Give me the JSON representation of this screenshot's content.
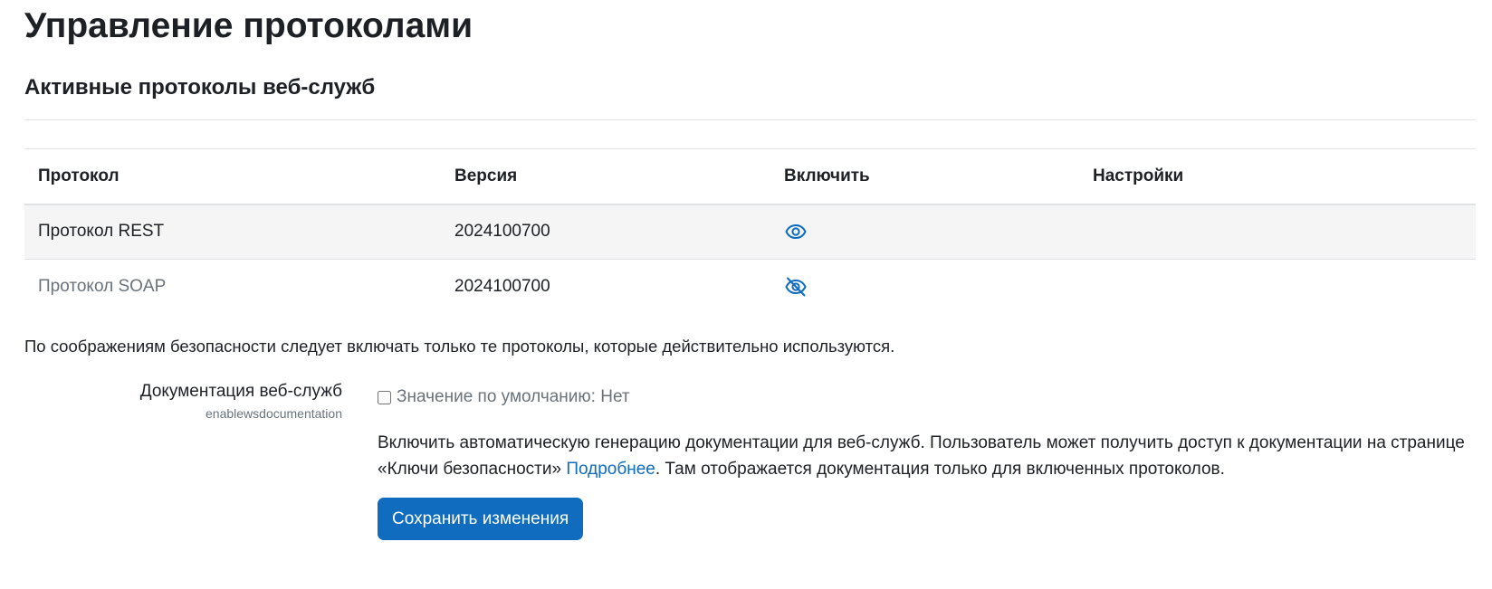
{
  "page": {
    "title": "Управление протоколами",
    "section_title": "Активные протоколы веб-служб"
  },
  "table": {
    "headers": {
      "protocol": "Протокол",
      "version": "Версия",
      "enable": "Включить",
      "settings": "Настройки"
    },
    "rows": [
      {
        "name": "Протокол REST",
        "version": "2024100700",
        "enabled": true,
        "enable_icon": "eye-icon",
        "settings": ""
      },
      {
        "name": "Протокол SOAP",
        "version": "2024100700",
        "enabled": false,
        "enable_icon": "eye-slash-icon",
        "settings": ""
      }
    ]
  },
  "security_note": "По соображениям безопасности следует включать только те протоколы, которые действительно используются.",
  "setting": {
    "label": "Документация веб-служб",
    "key": "enablewsdocumentation",
    "default_text": "Значение по умолчанию: Нет",
    "checked": false,
    "description_before": "Включить автоматическую генерацию документации для веб-служб. Пользователь может получить доступ к документации на странице «Ключи безопасности» ",
    "description_link": "Подробнее",
    "description_after": ". Там отображается документация только для включенных протоколов."
  },
  "save_button": "Сохранить изменения",
  "colors": {
    "primary": "#0f6cbf",
    "muted_text": "#6a737b",
    "row_highlight": "#f5f5f5",
    "border": "#dee2e6"
  }
}
